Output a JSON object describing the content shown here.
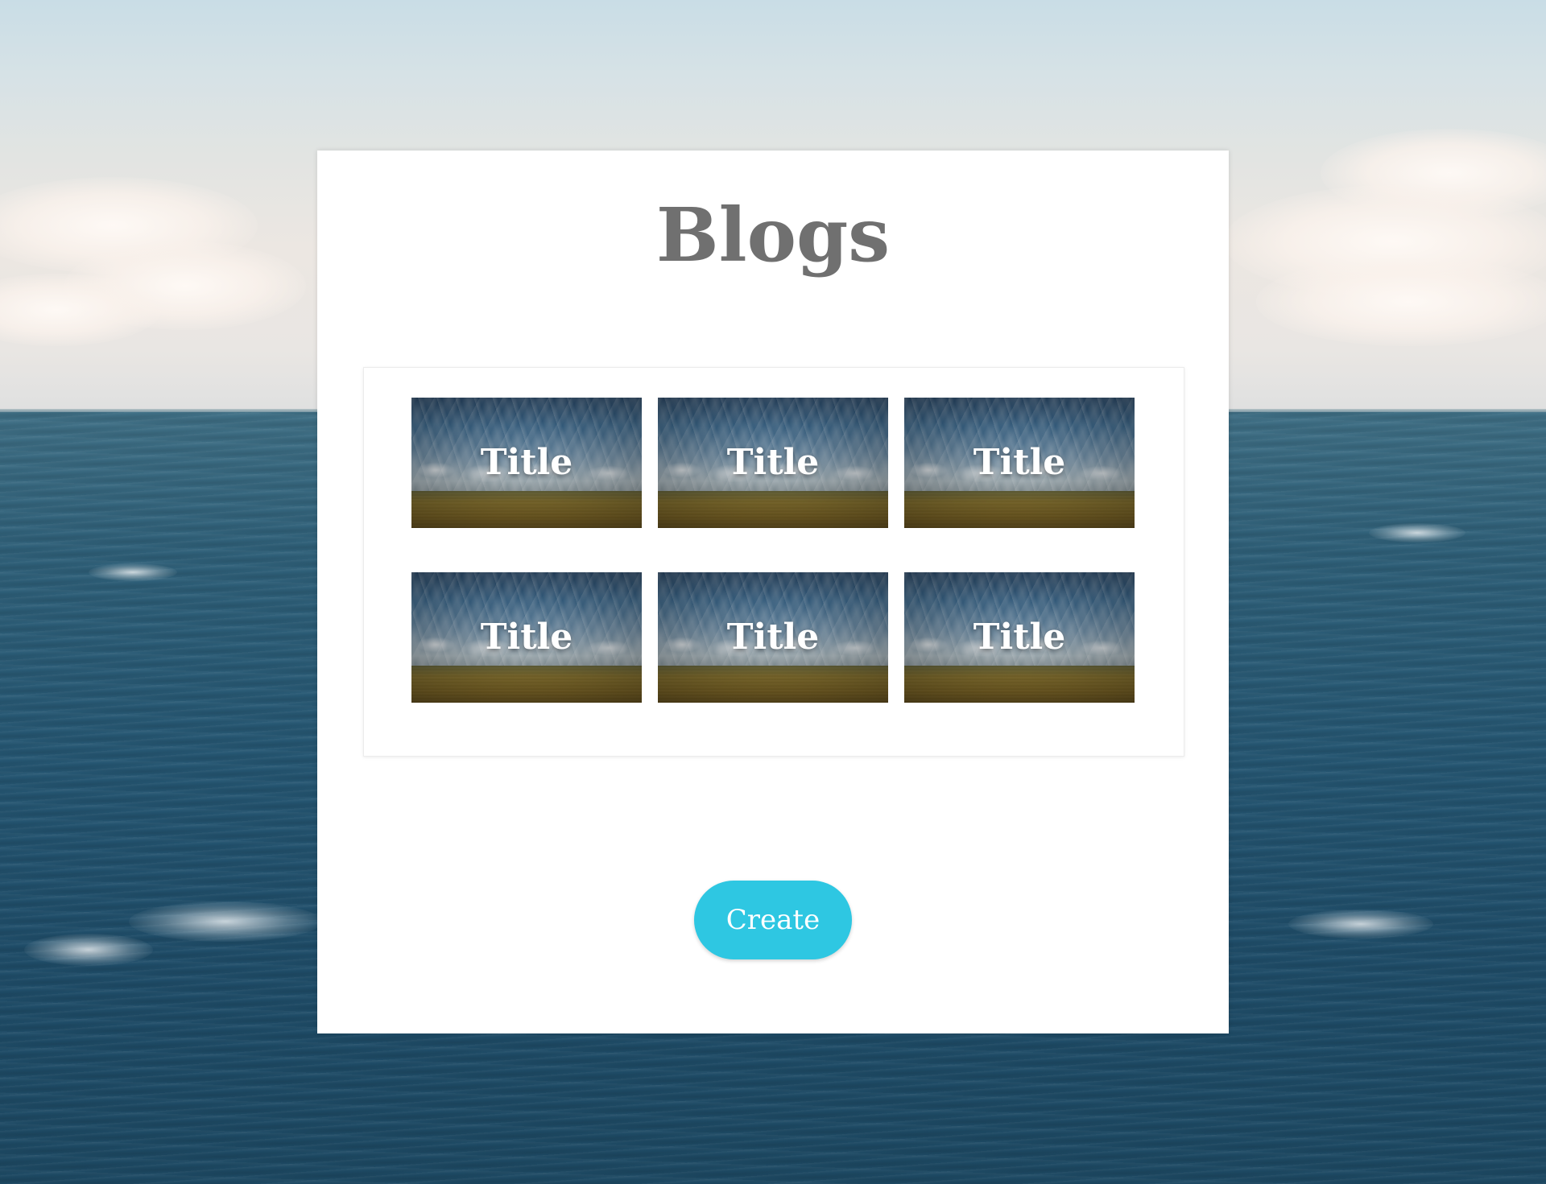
{
  "page": {
    "title": "Blogs"
  },
  "blogs": [
    {
      "title": "Title"
    },
    {
      "title": "Title"
    },
    {
      "title": "Title"
    },
    {
      "title": "Title"
    },
    {
      "title": "Title"
    },
    {
      "title": "Title"
    }
  ],
  "actions": {
    "create_label": "Create"
  },
  "colors": {
    "accent": "#2ec7e2",
    "title_text": "#707070",
    "panel_background": "#ffffff"
  }
}
